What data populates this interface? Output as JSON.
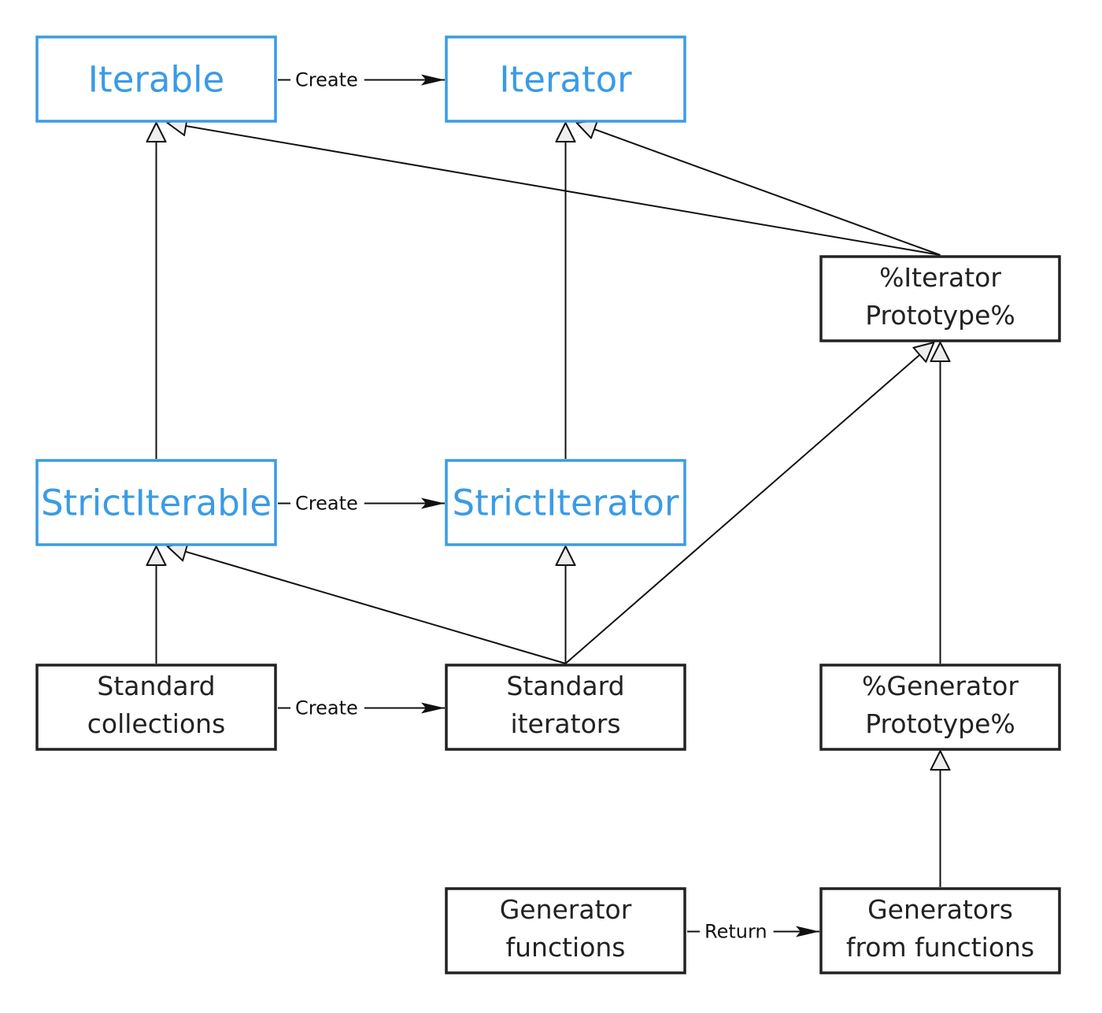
{
  "colors": {
    "interface": "#3a9be6",
    "concrete": "#222222",
    "hollow_arrow_fill": "#eeeeee"
  },
  "nodes": [
    {
      "id": "iterable",
      "lines": [
        "Iterable"
      ],
      "kind": "interface"
    },
    {
      "id": "iterator",
      "lines": [
        "Iterator"
      ],
      "kind": "interface"
    },
    {
      "id": "iterator-prototype",
      "lines": [
        "%Iterator",
        "Prototype%"
      ],
      "kind": "concrete"
    },
    {
      "id": "strict-iterable",
      "lines": [
        "StrictIterable"
      ],
      "kind": "interface"
    },
    {
      "id": "strict-iterator",
      "lines": [
        "StrictIterator"
      ],
      "kind": "interface"
    },
    {
      "id": "standard-collections",
      "lines": [
        "Standard",
        "collections"
      ],
      "kind": "concrete"
    },
    {
      "id": "standard-iterators",
      "lines": [
        "Standard",
        "iterators"
      ],
      "kind": "concrete"
    },
    {
      "id": "generator-prototype",
      "lines": [
        "%Generator",
        "Prototype%"
      ],
      "kind": "concrete"
    },
    {
      "id": "generator-functions",
      "lines": [
        "Generator",
        "functions"
      ],
      "kind": "concrete"
    },
    {
      "id": "generators-from-functions",
      "lines": [
        "Generators",
        "from functions"
      ],
      "kind": "concrete"
    }
  ],
  "inherits": [
    {
      "from": "strict-iterable",
      "to": "iterable"
    },
    {
      "from": "iterator-prototype",
      "to": "iterable"
    },
    {
      "from": "strict-iterator",
      "to": "iterator"
    },
    {
      "from": "iterator-prototype",
      "to": "iterator"
    },
    {
      "from": "standard-collections",
      "to": "strict-iterable"
    },
    {
      "from": "standard-iterators",
      "to": "strict-iterable"
    },
    {
      "from": "standard-iterators",
      "to": "strict-iterator"
    },
    {
      "from": "standard-iterators",
      "to": "iterator-prototype"
    },
    {
      "from": "generator-prototype",
      "to": "iterator-prototype"
    },
    {
      "from": "generators-from-functions",
      "to": "generator-prototype"
    }
  ],
  "relations": [
    {
      "from": "iterable",
      "to": "iterator",
      "label": "Create"
    },
    {
      "from": "strict-iterable",
      "to": "strict-iterator",
      "label": "Create"
    },
    {
      "from": "standard-collections",
      "to": "standard-iterators",
      "label": "Create"
    },
    {
      "from": "generator-functions",
      "to": "generators-from-functions",
      "label": "Return"
    }
  ]
}
